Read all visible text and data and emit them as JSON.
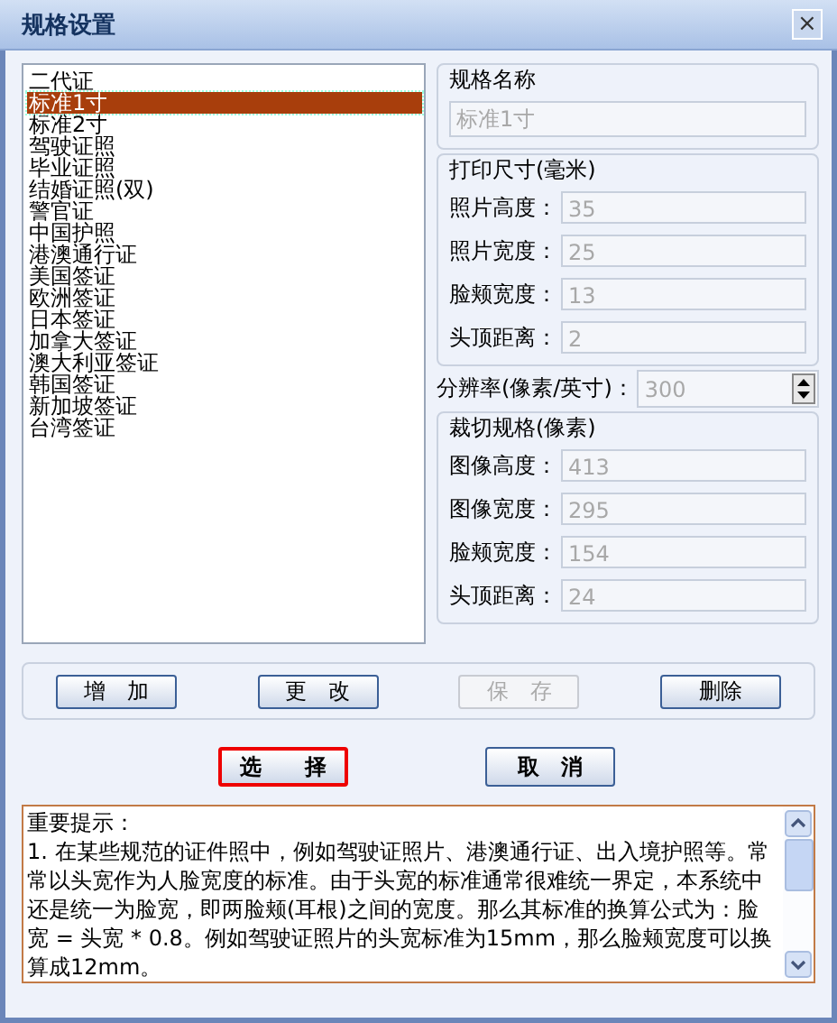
{
  "window": {
    "title": "规格设置",
    "close": "×"
  },
  "spec_list": {
    "items": [
      {
        "label": "二代证",
        "selected": false
      },
      {
        "label": "标准1寸",
        "selected": true
      },
      {
        "label": "标准2寸",
        "selected": false
      },
      {
        "label": "驾驶证照",
        "selected": false
      },
      {
        "label": "毕业证照",
        "selected": false
      },
      {
        "label": "结婚证照(双)",
        "selected": false
      },
      {
        "label": "警官证",
        "selected": false
      },
      {
        "label": "中国护照",
        "selected": false
      },
      {
        "label": "港澳通行证",
        "selected": false
      },
      {
        "label": "美国签证",
        "selected": false
      },
      {
        "label": "欧洲签证",
        "selected": false
      },
      {
        "label": "日本签证",
        "selected": false
      },
      {
        "label": "加拿大签证",
        "selected": false
      },
      {
        "label": "澳大利亚签证",
        "selected": false
      },
      {
        "label": "韩国签证",
        "selected": false
      },
      {
        "label": "新加坡签证",
        "selected": false
      },
      {
        "label": "台湾签证",
        "selected": false
      }
    ]
  },
  "name_group": {
    "title": "规格名称",
    "value": "标准1寸",
    "disabled": true
  },
  "print_group": {
    "title": "打印尺寸(毫米)",
    "fields": [
      {
        "label": "照片高度：",
        "value": "35",
        "disabled": true
      },
      {
        "label": "照片宽度：",
        "value": "25",
        "disabled": true
      },
      {
        "label": "脸颊宽度：",
        "value": "13",
        "disabled": true
      },
      {
        "label": "头顶距离：",
        "value": "2",
        "disabled": true
      }
    ]
  },
  "resolution": {
    "label": "分辨率(像素/英寸)：",
    "value": "300",
    "disabled": true
  },
  "crop_group": {
    "title": "裁切规格(像素)",
    "fields": [
      {
        "label": "图像高度：",
        "value": "413",
        "disabled": true
      },
      {
        "label": "图像宽度：",
        "value": "295",
        "disabled": true
      },
      {
        "label": "脸颊宽度：",
        "value": "154",
        "disabled": true
      },
      {
        "label": "头顶距离：",
        "value": "24",
        "disabled": true
      }
    ]
  },
  "action_buttons": [
    {
      "label": "增　加",
      "disabled": false
    },
    {
      "label": "更　改",
      "disabled": false
    },
    {
      "label": "保　存",
      "disabled": true
    },
    {
      "label": "删除",
      "disabled": false
    }
  ],
  "dialog_buttons": [
    {
      "label": "选　　择",
      "default": true
    },
    {
      "label": "取　消",
      "default": false
    }
  ],
  "notes": {
    "heading": "重要提示：",
    "body": "1. 在某些规范的证件照中，例如驾驶证照片、港澳通行证、出入境护照等。常常以头宽作为人脸宽度的标准。由于头宽的标准通常很难统一界定，本系统中还是统一为脸宽，即两脸颊(耳根)之间的宽度。那么其标准的换算公式为：脸宽 = 头宽 * 0.8。例如驾驶证照片的头宽标准为15mm，那么脸颊宽度可以换算成12mm。"
  }
}
